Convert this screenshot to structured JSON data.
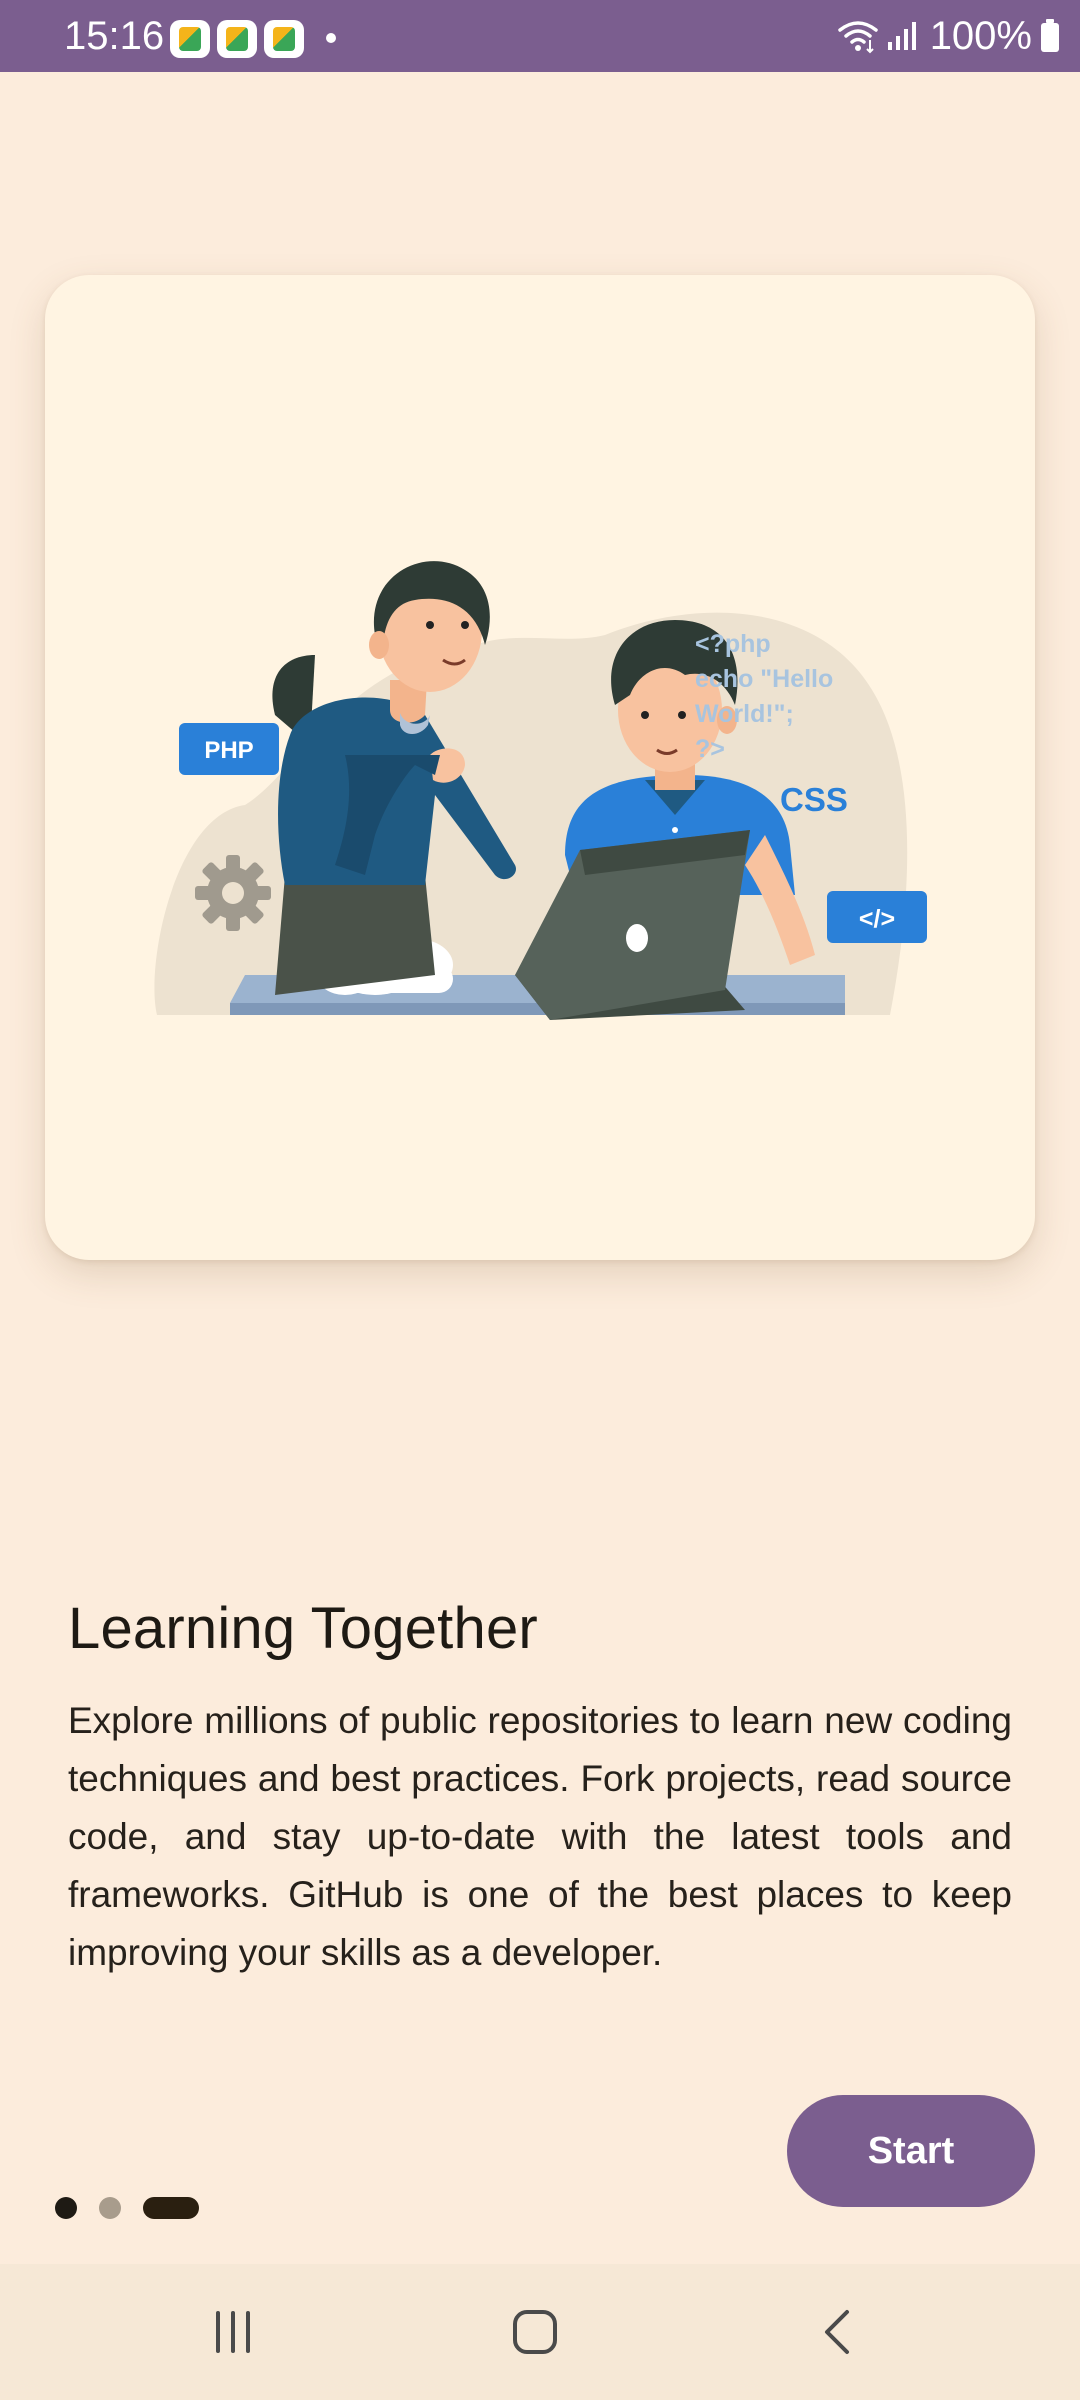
{
  "status_bar": {
    "time": "15:16",
    "battery": "100%",
    "background": "#7b5e8f",
    "icons": [
      "app-notification-icon",
      "app-notification-icon",
      "app-notification-icon",
      "notification-dot",
      "wifi-icon",
      "signal-icon",
      "battery-icon"
    ]
  },
  "illustration": {
    "badge_php": "PHP",
    "code_lines": [
      "<?php",
      "echo \"Hello",
      "World!\";",
      "?>"
    ],
    "badge_css": "CSS",
    "badge_tag": "</>"
  },
  "content": {
    "title": "Learning Together",
    "body": "Explore millions of public repositories to learn new coding techniques and best practices. Fork projects, read source code, and stay up-to-date with the latest tools and frameworks. GitHub is one of the best places to keep improving your skills as a developer."
  },
  "pager": {
    "page_count": 3,
    "current_page": 3
  },
  "actions": {
    "start_label": "Start"
  },
  "nav_bar": {
    "buttons": [
      "recent-apps-icon",
      "home-icon",
      "back-icon"
    ]
  },
  "colors": {
    "accent": "#7b5e8f",
    "background": "#fcecdc",
    "card": "#fff4e2",
    "code_blue": "#2a80d8",
    "code_text": "#a8c4df"
  }
}
